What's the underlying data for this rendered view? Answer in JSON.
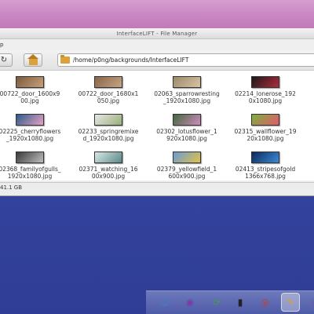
{
  "window": {
    "title": "InterfaceLIFT - File Manager",
    "menu_fragment": "p"
  },
  "toolbar": {
    "path": "/home/p0ng/backgrounds/InterfaceLIFT"
  },
  "files": [
    {
      "name": "00722_door_1600x900.jpg",
      "display": "00722_door_1600x9\n00.jpg",
      "colors": [
        "#7a5a3e",
        "#c9a07a"
      ],
      "shape": "wide"
    },
    {
      "name": "00722_door_1680x1050.jpg",
      "display": "00722_door_1680x1\n050.jpg",
      "colors": [
        "#8a6548",
        "#c5a584"
      ],
      "shape": "wide"
    },
    {
      "name": "02063_sparrowresting_1920x1080.jpg",
      "display": "02063_sparrowresting\n_1920x1080.jpg",
      "colors": [
        "#9a8a6a",
        "#d9c3a3"
      ],
      "shape": "wide"
    },
    {
      "name": "02214_lonerose_1920x1080.jpg",
      "display": "02214_lonerose_192\n0x1080.jpg",
      "colors": [
        "#1a1a1a",
        "#b22a3a"
      ],
      "shape": "wide"
    },
    {
      "name": "02225_cherryflowers_1920x1080.jpg",
      "display": "02225_cherryflowers\n_1920x1080.jpg",
      "colors": [
        "#2d5a8a",
        "#e7a3c4"
      ],
      "shape": "wide"
    },
    {
      "name": "02233_springremixed_1920x1080.jpg",
      "display": "02233_springremixe\nd_1920x1080.jpg",
      "colors": [
        "#e6e6e6",
        "#9bb07a"
      ],
      "shape": "wide"
    },
    {
      "name": "02302_lotusflower_1920x1080.jpg",
      "display": "02302_lotusflower_1\n920x1080.jpg",
      "colors": [
        "#3d6a3a",
        "#d58abf"
      ],
      "shape": "wide"
    },
    {
      "name": "02315_wallflower_1920x1080.jpg",
      "display": "02315_wallflower_19\n20x1080.jpg",
      "colors": [
        "#7ab03e",
        "#e55a6a"
      ],
      "shape": "wide"
    },
    {
      "name": "02368_familyofgulls_1920x1080.jpg",
      "display": "02368_familyofgulls_\n1920x1080.jpg",
      "colors": [
        "#3a3a3a",
        "#bdbdbd"
      ],
      "shape": "wide"
    },
    {
      "name": "02371_watching_1600x900.jpg",
      "display": "02371_watching_16\n00x900.jpg",
      "colors": [
        "#d8e8e6",
        "#5a8a88"
      ],
      "shape": "wide"
    },
    {
      "name": "02379_yellowfield_1600x900.jpg",
      "display": "02379_yellowfield_1\n600x900.jpg",
      "colors": [
        "#6a9ad2",
        "#e0c24a"
      ],
      "shape": "wide"
    },
    {
      "name": "02413_stripesofgold_1366x768.jpg",
      "display": "02413_stripesofgold\n1366x768.jpg",
      "colors": [
        "#0e2a5a",
        "#3a8ad8"
      ],
      "shape": "wide"
    }
  ],
  "status": {
    "text": "41.1 GB"
  },
  "dock": {
    "items": [
      {
        "name": "finder-icon",
        "glyph": "☺",
        "color": "#4a7ac8"
      },
      {
        "name": "pidgin-icon",
        "glyph": "◉",
        "color": "#7a3aa8"
      },
      {
        "name": "network-icon",
        "glyph": "⟳",
        "color": "#4a9a4a"
      },
      {
        "name": "terminal-icon",
        "glyph": "▮",
        "color": "#222222"
      },
      {
        "name": "browser-icon",
        "glyph": "◎",
        "color": "#c83a2a"
      },
      {
        "name": "text-editor-icon",
        "glyph": "✎",
        "color": "#e0a030"
      },
      {
        "name": "media-icon",
        "glyph": "▣",
        "color": "#6a5aa8"
      }
    ]
  }
}
